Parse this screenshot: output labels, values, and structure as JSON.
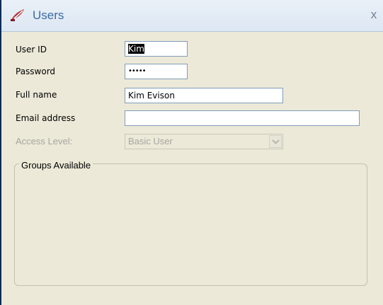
{
  "window": {
    "title": "Users",
    "close_label": "x",
    "icon": "users-app-icon"
  },
  "form": {
    "user_id": {
      "label": "User ID",
      "value": "Kim"
    },
    "password": {
      "label": "Password",
      "value": "•••••"
    },
    "full_name": {
      "label": "Full name",
      "value": "Kim Evison"
    },
    "email": {
      "label": "Email address",
      "value": ""
    },
    "access_level": {
      "label": "Access Level:",
      "value": "Basic User"
    }
  },
  "groups": {
    "legend": "Groups Available"
  }
}
